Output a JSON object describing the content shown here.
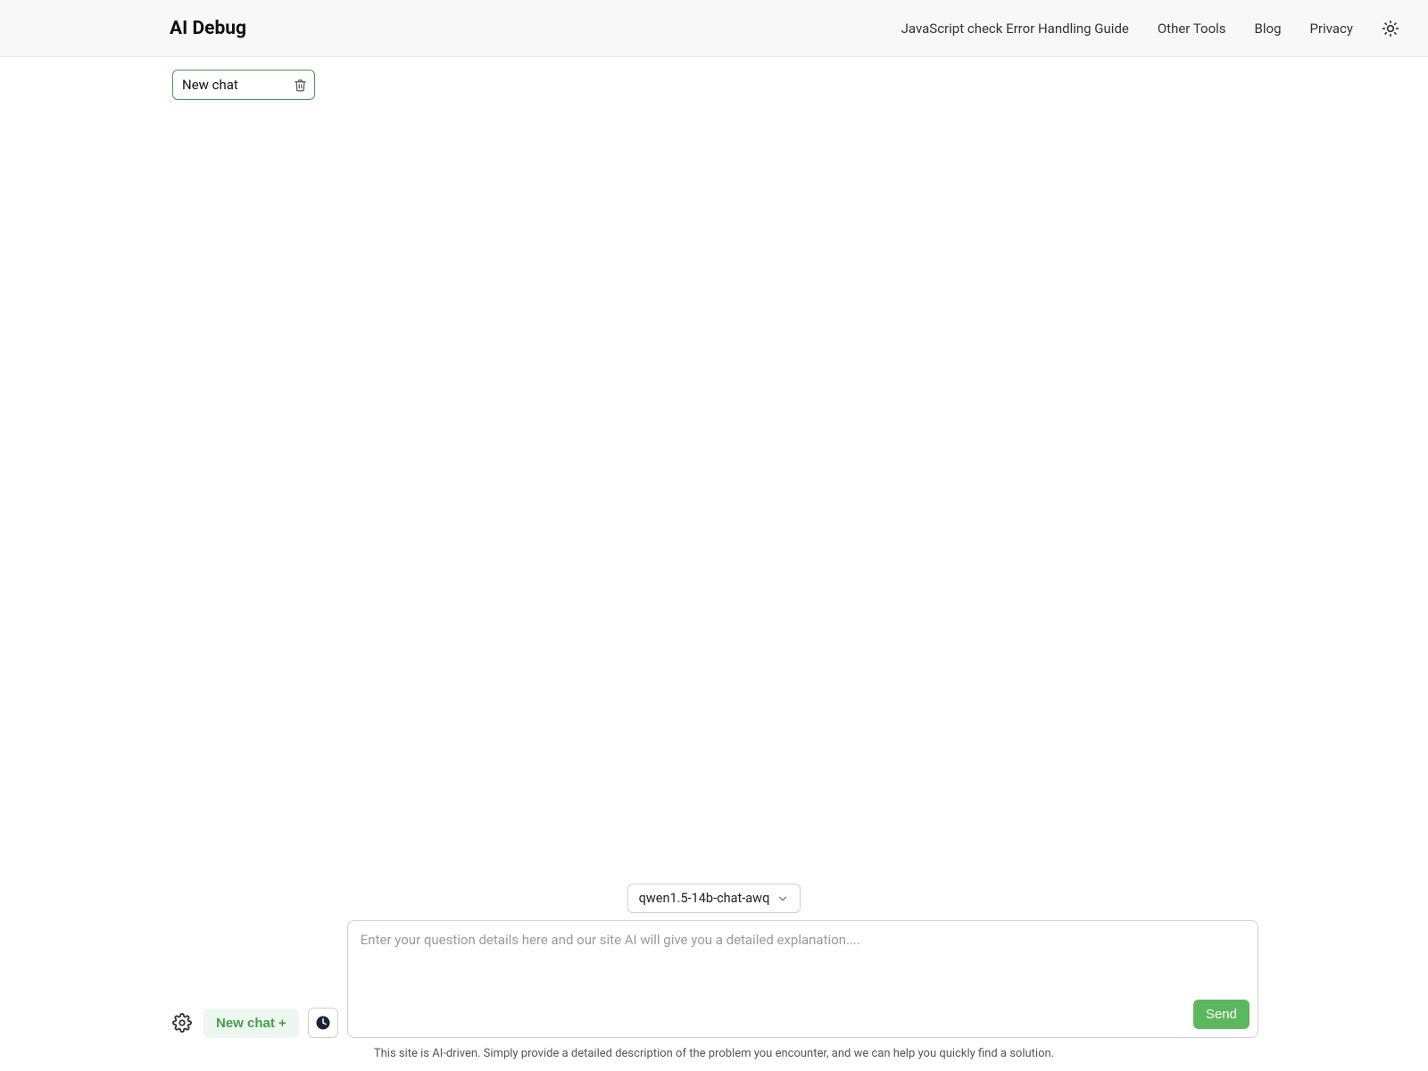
{
  "header": {
    "logo": "AI Debug",
    "nav": {
      "guide": "JavaScript check Error Handling Guide",
      "other_tools": "Other Tools",
      "blog": "Blog",
      "privacy": "Privacy"
    }
  },
  "sidebar": {
    "active_chat": "New chat"
  },
  "composer": {
    "model_selected": "qwen1.5-14b-chat-awq",
    "placeholder": "Enter your question details here and our site AI will give you a detailed explanation....",
    "new_chat_label": "New chat +",
    "send_label": "Send"
  },
  "footer": {
    "note": "This site is AI-driven. Simply provide a detailed description of the problem you encounter, and we can help you quickly find a solution."
  }
}
